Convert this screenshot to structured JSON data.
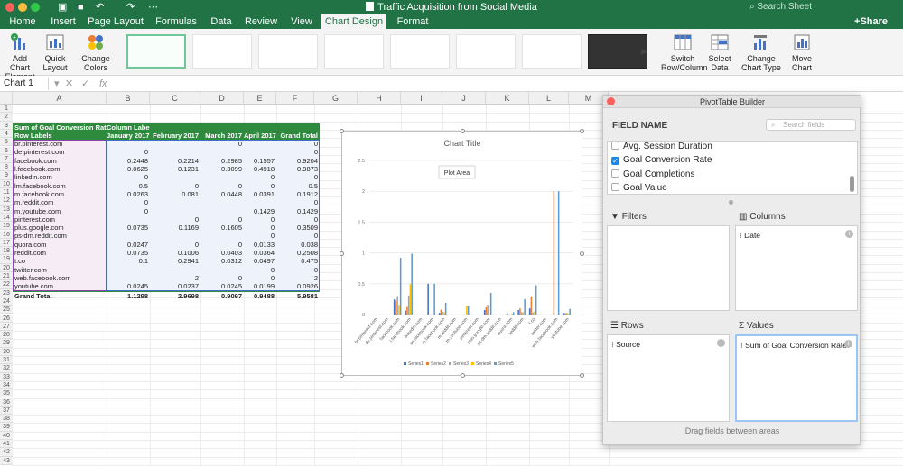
{
  "window": {
    "title": "Traffic Acquisition from Social Media",
    "search_placeholder": "Search Sheet",
    "share_label": "Share"
  },
  "tabs": [
    {
      "label": "Home",
      "active": false
    },
    {
      "label": "Insert",
      "active": false
    },
    {
      "label": "Page Layout",
      "active": false
    },
    {
      "label": "Formulas",
      "active": false
    },
    {
      "label": "Data",
      "active": false
    },
    {
      "label": "Review",
      "active": false
    },
    {
      "label": "View",
      "active": false
    },
    {
      "label": "Chart Design",
      "active": true
    },
    {
      "label": "Format",
      "active": false
    }
  ],
  "ribbon": {
    "add_chart_element": "Add Chart Element",
    "quick_layout": "Quick Layout",
    "change_colors": "Change Colors",
    "switch_row_column": "Switch Row/Column",
    "select_data": "Select Data",
    "change_chart_type": "Change Chart Type",
    "move_chart": "Move Chart"
  },
  "formula_bar": {
    "name_box": "Chart 1",
    "fx": "fx"
  },
  "columns": [
    "A",
    "B",
    "C",
    "D",
    "E",
    "F",
    "G",
    "H",
    "I",
    "J",
    "K",
    "L",
    "M"
  ],
  "rows": [
    "1",
    "2",
    "3",
    "4",
    "5",
    "6",
    "7",
    "8",
    "9",
    "10",
    "11",
    "12",
    "13",
    "14",
    "15",
    "16",
    "17",
    "18",
    "19",
    "20",
    "21",
    "22",
    "23",
    "24",
    "25",
    "26",
    "27",
    "28",
    "29",
    "30",
    "31",
    "32",
    "33",
    "34",
    "35",
    "36",
    "37",
    "38",
    "39",
    "40",
    "41",
    "42",
    "43"
  ],
  "pivot": {
    "header1": [
      "Sum of Goal Conversion Rate",
      "Column Labels",
      "",
      "",
      "",
      ""
    ],
    "header2": [
      "Row Labels",
      "January 2017",
      "February 2017",
      "March 2017",
      "April 2017",
      "Grand Total"
    ],
    "rows": [
      [
        "br.pinterest.com",
        "",
        "",
        "0",
        "",
        "0"
      ],
      [
        "de.pinterest.com",
        "0",
        "",
        "",
        "",
        "0"
      ],
      [
        "facebook.com",
        "0.2448",
        "0.2214",
        "0.2985",
        "0.1557",
        "0.9204"
      ],
      [
        "l.facebook.com",
        "0.0625",
        "0.1231",
        "0.3099",
        "0.4918",
        "0.9873"
      ],
      [
        "linkedin.com",
        "0",
        "",
        "",
        "0",
        "0"
      ],
      [
        "lm.facebook.com",
        "0.5",
        "0",
        "0",
        "0",
        "0.5"
      ],
      [
        "m.facebook.com",
        "0.0263",
        "0.081",
        "0.0448",
        "0.0391",
        "0.1912"
      ],
      [
        "m.reddit.com",
        "0",
        "",
        "",
        "",
        "0"
      ],
      [
        "m.youtube.com",
        "0",
        "",
        "",
        "0.1429",
        "0.1429"
      ],
      [
        "pinterest.com",
        "",
        "0",
        "0",
        "0",
        "0"
      ],
      [
        "plus.google.com",
        "0.0735",
        "0.1169",
        "0.1605",
        "0",
        "0.3509"
      ],
      [
        "ps-dm.reddit.com",
        "",
        "",
        "",
        "0",
        "0"
      ],
      [
        "quora.com",
        "0.0247",
        "0",
        "0",
        "0.0133",
        "0.038"
      ],
      [
        "reddit.com",
        "0.0735",
        "0.1006",
        "0.0403",
        "0.0364",
        "0.2508"
      ],
      [
        "t.co",
        "0.1",
        "0.2941",
        "0.0312",
        "0.0497",
        "0.475"
      ],
      [
        "twitter.com",
        "",
        "",
        "",
        "0",
        "0"
      ],
      [
        "web.facebook.com",
        "",
        "2",
        "0",
        "0",
        "2"
      ],
      [
        "youtube.com",
        "0.0245",
        "0.0237",
        "0.0245",
        "0.0199",
        "0.0926"
      ]
    ],
    "total": [
      "Grand Total",
      "1.1298",
      "2.9698",
      "0.9097",
      "0.9488",
      "5.9581"
    ]
  },
  "chart_data": {
    "type": "bar",
    "title": "Chart Title",
    "tooltip": "Plot Area",
    "categories": [
      "br.pinterest.com",
      "de.pinterest.com",
      "facebook.com",
      "l.facebook.com",
      "linkedin.com",
      "lm.facebook.com",
      "m.facebook.com",
      "m.reddit.com",
      "m.youtube.com",
      "pinterest.com",
      "plus.google.com",
      "ps-dm.reddit.com",
      "quora.com",
      "reddit.com",
      "t.co",
      "twitter.com",
      "web.facebook.com",
      "youtube.com"
    ],
    "series": [
      {
        "name": "Series1",
        "color": "#4472c4",
        "values": [
          0,
          0,
          0.2448,
          0.0625,
          0,
          0.5,
          0.0263,
          0,
          0,
          0,
          0.0735,
          0,
          0.0247,
          0.0735,
          0.1,
          0,
          0,
          0.0245
        ]
      },
      {
        "name": "Series2",
        "color": "#ed7d31",
        "values": [
          0,
          0,
          0.2214,
          0.1231,
          0,
          0,
          0.081,
          0,
          0,
          0,
          0.1169,
          0,
          0,
          0.1006,
          0.2941,
          0,
          2,
          0.0237
        ]
      },
      {
        "name": "Series3",
        "color": "#a5a5a5",
        "values": [
          0,
          0,
          0.2985,
          0.3099,
          0,
          0,
          0.0448,
          0,
          0,
          0,
          0.1605,
          0,
          0,
          0.0403,
          0.0312,
          0,
          0,
          0.0245
        ]
      },
      {
        "name": "Series4",
        "color": "#ffc000",
        "values": [
          0,
          0,
          0.1557,
          0.4918,
          0,
          0,
          0.0391,
          0,
          0.1429,
          0,
          0,
          0,
          0.0133,
          0.0364,
          0.0497,
          0,
          0,
          0.0199
        ]
      },
      {
        "name": "Series5",
        "color": "#5b9bd5",
        "values": [
          0,
          0,
          0.9204,
          0.9873,
          0,
          0.5,
          0.1912,
          0,
          0.1429,
          0,
          0.3509,
          0,
          0.038,
          0.2508,
          0.475,
          0,
          2,
          0.0926
        ]
      }
    ],
    "ylim": [
      0,
      2.5
    ],
    "yticks": [
      "0",
      "0.5",
      "1",
      "1.5",
      "2",
      "2.5"
    ],
    "grid": true,
    "legend": "bottom"
  },
  "pivot_builder": {
    "title": "PivotTable Builder",
    "field_name": "FIELD NAME",
    "search_placeholder": "Search fields",
    "fields": [
      {
        "label": "Avg. Session Duration",
        "checked": false
      },
      {
        "label": "Goal Conversion Rate",
        "checked": true
      },
      {
        "label": "Goal Completions",
        "checked": false
      },
      {
        "label": "Goal Value",
        "checked": false
      }
    ],
    "filters_label": "Filters",
    "columns_label": "Columns",
    "columns_item": "Date",
    "rows_label": "Rows",
    "rows_item": "Source",
    "values_label": "Values",
    "values_item": "Sum of Goal Conversion Rate",
    "drag_hint": "Drag fields between areas"
  }
}
